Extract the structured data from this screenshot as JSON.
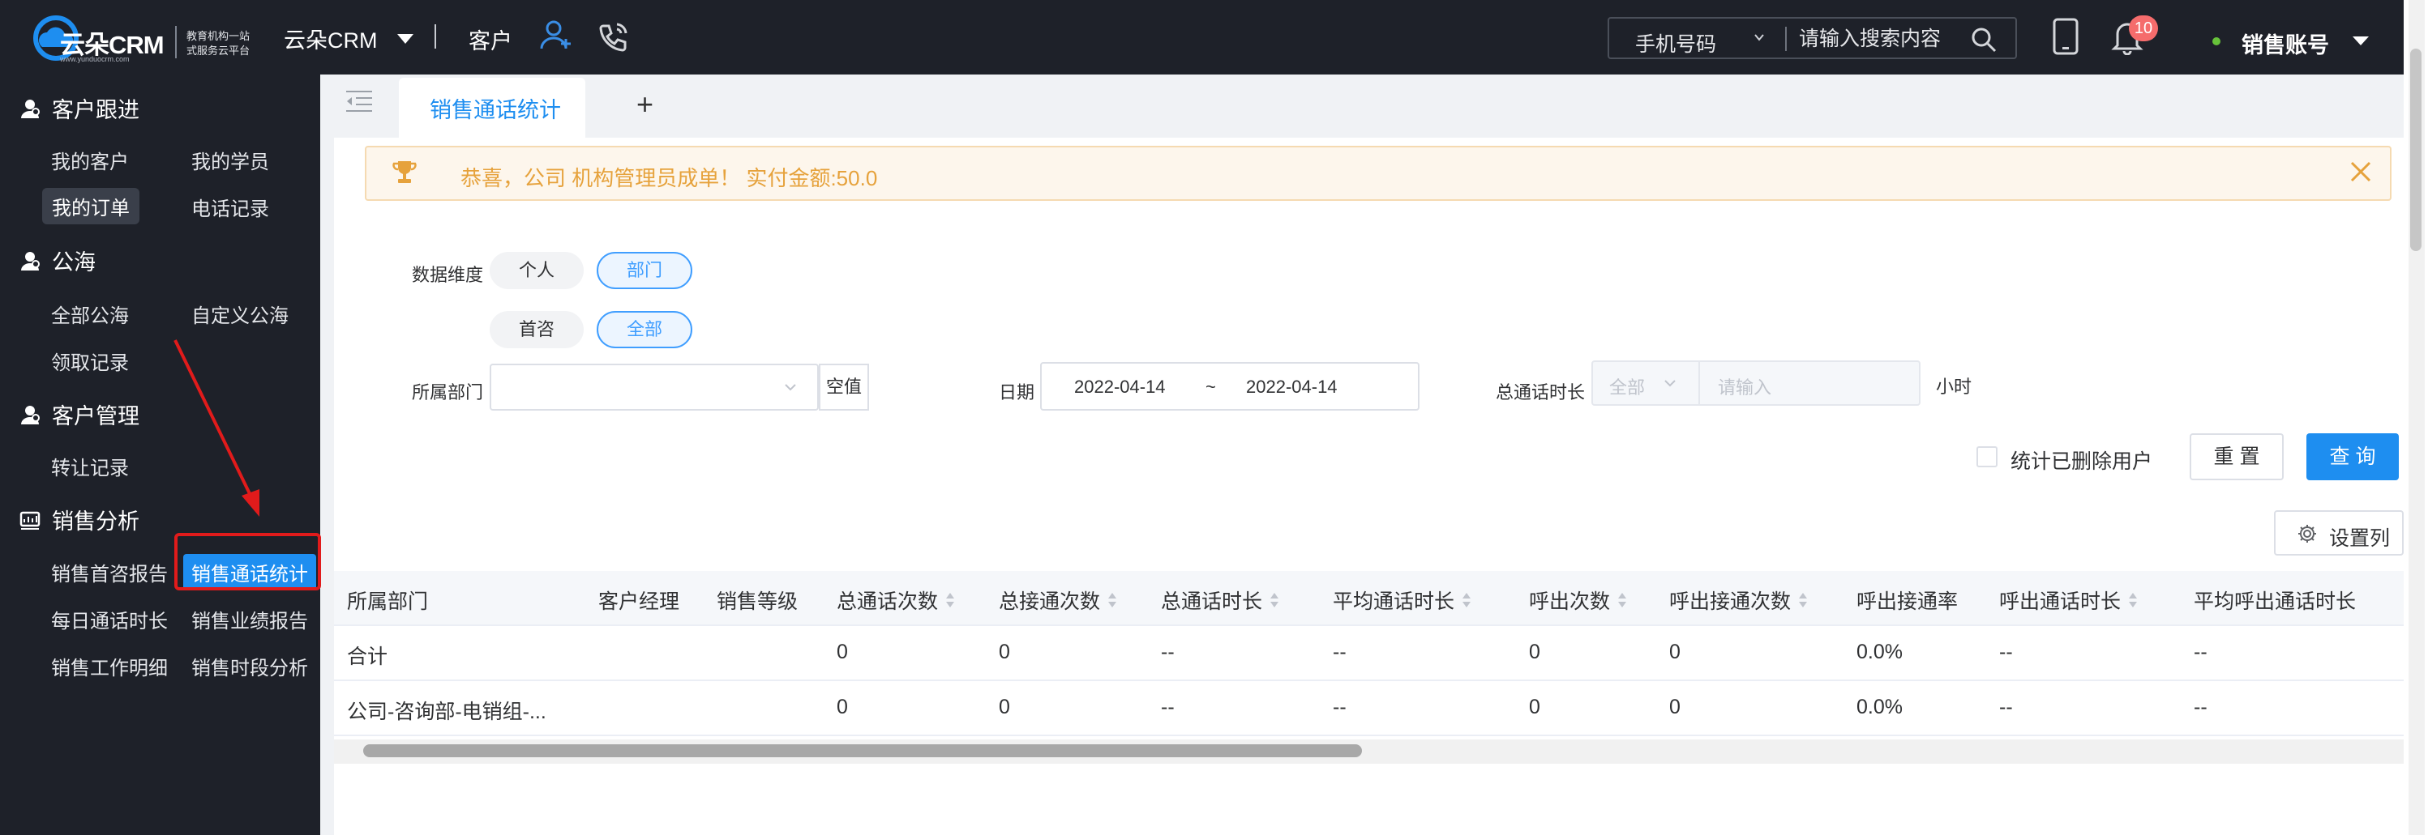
{
  "topbar": {
    "logo_text": "云朵CRM",
    "logo_url": "www.yunduocrm.com",
    "logo_slogan": "教育机构一站式服务云平台",
    "app_name": "云朵CRM",
    "customer_label": "客户",
    "search_type": "手机号码",
    "search_placeholder": "请输入搜索内容",
    "notification_count": "10",
    "account_name": "销售账号"
  },
  "sidebar": {
    "groups": [
      {
        "title": "客户跟进",
        "items": [
          "我的客户",
          "我的学员",
          "我的订单",
          "电话记录"
        ]
      },
      {
        "title": "公海",
        "items": [
          "全部公海",
          "自定义公海",
          "领取记录"
        ]
      },
      {
        "title": "客户管理",
        "items": [
          "转让记录"
        ]
      },
      {
        "title": "销售分析",
        "items": [
          "销售首咨报告",
          "销售通话统计",
          "每日通话时长",
          "销售业绩报告",
          "销售工作明细",
          "销售时段分析"
        ]
      }
    ]
  },
  "tabs": {
    "active_label": "销售通话统计",
    "add_label": "+"
  },
  "notice": {
    "message": "恭喜，公司 机构管理员成单！  实付金额:50.0"
  },
  "filters": {
    "dimension_label": "数据维度",
    "dimension_options": [
      "个人",
      "部门"
    ],
    "scope_options": [
      "首咨",
      "全部"
    ],
    "department_label": "所属部门",
    "empty_button": "空值",
    "date_label": "日期",
    "date_start": "2022-04-14",
    "date_sep": "~",
    "date_end": "2022-04-14",
    "duration_label": "总通话时长",
    "duration_operator": "全部",
    "duration_placeholder": "请输入",
    "duration_unit": "小时",
    "deleted_users_label": "统计已删除用户",
    "reset_label": "重 置",
    "query_label": "查 询",
    "columns_label": "设置列"
  },
  "table": {
    "headers": [
      "所属部门",
      "客户经理",
      "销售等级",
      "总通话次数",
      "总接通次数",
      "总通话时长",
      "平均通话时长",
      "呼出次数",
      "呼出接通次数",
      "呼出接通率",
      "呼出通话时长",
      "平均呼出通话时长"
    ],
    "rows": [
      [
        "合计",
        "",
        "",
        "0",
        "0",
        "--",
        "--",
        "0",
        "0",
        "0.0%",
        "--",
        "--"
      ],
      [
        "公司-咨询部-电销组-...",
        "",
        "",
        "0",
        "0",
        "--",
        "--",
        "0",
        "0",
        "0.0%",
        "--",
        "--"
      ]
    ]
  },
  "colors": {
    "topbar_bg": "#1e2129",
    "accent": "#1e8ef0",
    "notice_text": "#e6a23c",
    "annotation_red": "#e11b1b"
  }
}
